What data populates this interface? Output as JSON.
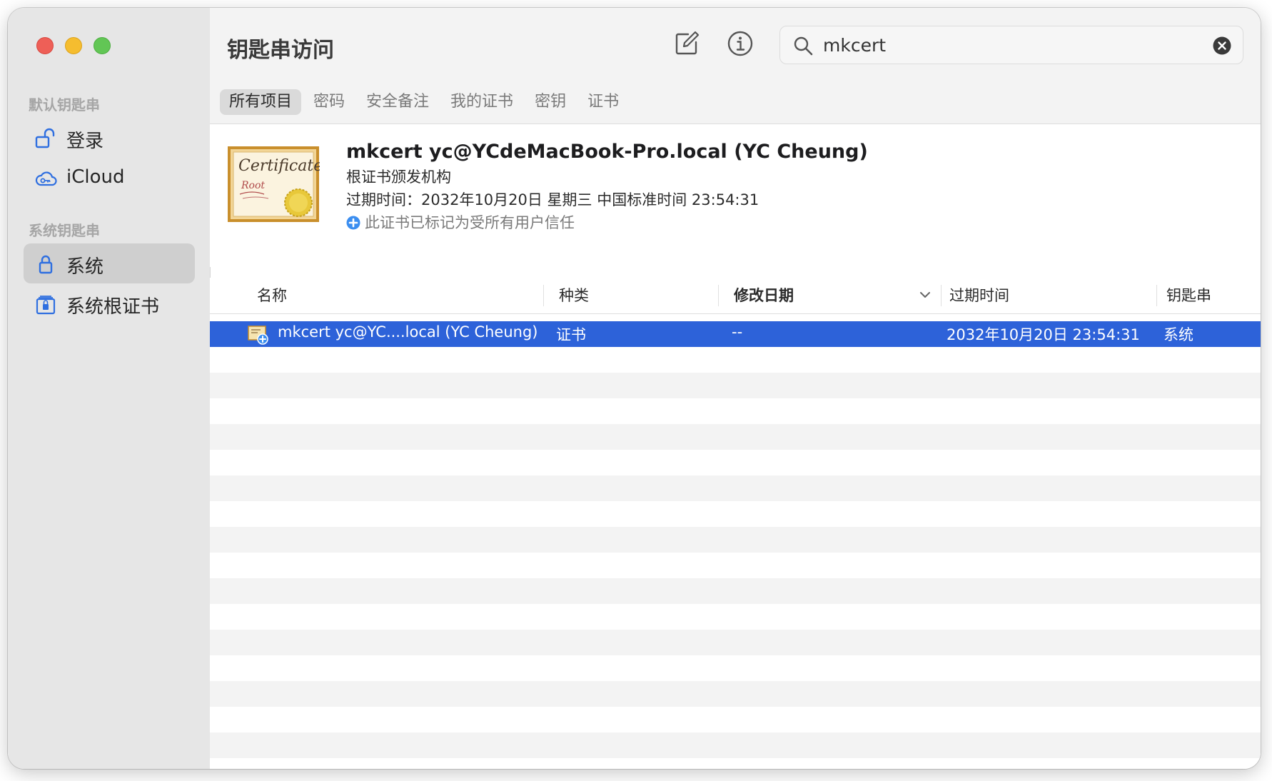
{
  "app": {
    "title": "钥匙串访问"
  },
  "search": {
    "value": "mkcert"
  },
  "sidebar": {
    "sections": [
      {
        "label": "默认钥匙串",
        "items": [
          {
            "label": "登录",
            "icon": "unlocked-padlock-icon",
            "selected": false
          },
          {
            "label": "iCloud",
            "icon": "icloud-key-icon",
            "selected": false
          }
        ]
      },
      {
        "label": "系统钥匙串",
        "items": [
          {
            "label": "系统",
            "icon": "padlock-icon",
            "selected": true
          },
          {
            "label": "系统根证书",
            "icon": "root-certificate-cabinet-icon",
            "selected": false
          }
        ]
      }
    ]
  },
  "tabs": [
    {
      "label": "所有项目",
      "active": true
    },
    {
      "label": "密码",
      "active": false
    },
    {
      "label": "安全备注",
      "active": false
    },
    {
      "label": "我的证书",
      "active": false
    },
    {
      "label": "密钥",
      "active": false
    },
    {
      "label": "证书",
      "active": false
    }
  ],
  "detail": {
    "name": "mkcert yc@YCdeMacBook-Pro.local (YC Cheung)",
    "kind": "根证书颁发机构",
    "expiry": "过期时间：2032年10月20日 星期三 中国标准时间 23:54:31",
    "trust": "此证书已标记为受所有用户信任",
    "cert_image_text": {
      "line1": "Certificate",
      "line2": "Root"
    }
  },
  "table": {
    "columns": [
      {
        "label": "名称",
        "sorted": false
      },
      {
        "label": "种类",
        "sorted": false
      },
      {
        "label": "修改日期",
        "sorted": true,
        "sort_direction": "descending"
      },
      {
        "label": "过期时间",
        "sorted": false
      },
      {
        "label": "钥匙串",
        "sorted": false
      }
    ],
    "rows": [
      {
        "name": "mkcert yc@YC....local (YC Cheung)",
        "kind": "证书",
        "modified": "--",
        "expires": "2032年10月20日 23:54:31",
        "keychain": "系统",
        "selected": true
      }
    ]
  },
  "colors": {
    "selection": "#2d62d9",
    "sidebar_bg": "#e6e6e6",
    "trust_blue": "#3b8ef0",
    "close": "#ee5f57",
    "minimize": "#f5bd2f",
    "zoom": "#62c655"
  }
}
